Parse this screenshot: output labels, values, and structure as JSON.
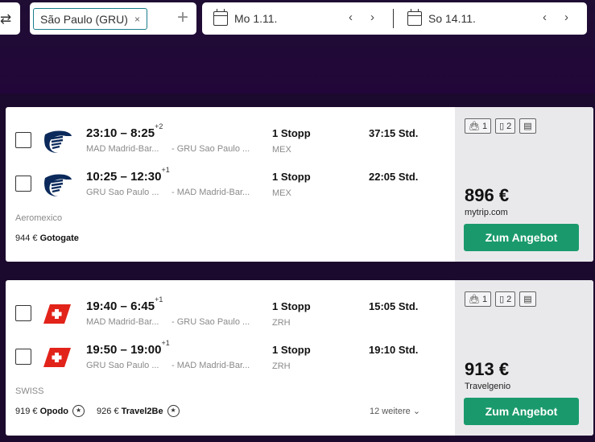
{
  "search": {
    "origin_chip": "São Paulo (GRU)",
    "chip_close": "×",
    "add_symbol": "+",
    "depart_date": "Mo 1.11.",
    "return_date": "So 14.11.",
    "prev": "‹",
    "next": "›",
    "swap_symbol": "⇄"
  },
  "results": [
    {
      "legs": [
        {
          "depart": "23:10",
          "arrive": "8:25",
          "plus_days": "+2",
          "from": "MAD Madrid-Bar...",
          "to": "- GRU Sao Paulo ...",
          "stops": "1 Stopp",
          "via": "MEX",
          "duration": "37:15 Std."
        },
        {
          "depart": "10:25",
          "arrive": "12:30",
          "plus_days": "+1",
          "from": "GRU Sao Paulo ...",
          "to": "- MAD Madrid-Bar...",
          "stops": "1 Stopp",
          "via": "MEX",
          "duration": "22:05 Std."
        }
      ],
      "airline": "Aeromexico",
      "alt_offers": [
        {
          "price": "944 €",
          "provider": "Gotogate"
        }
      ],
      "bags": [
        "1",
        "2"
      ],
      "price": "896 €",
      "provider": "mytrip.com",
      "cta": "Zum Angebot",
      "logo_color": "#0b2a5b"
    },
    {
      "legs": [
        {
          "depart": "19:40",
          "arrive": "6:45",
          "plus_days": "+1",
          "from": "MAD Madrid-Bar...",
          "to": "- GRU Sao Paulo ...",
          "stops": "1 Stopp",
          "via": "ZRH",
          "duration": "15:05 Std."
        },
        {
          "depart": "19:50",
          "arrive": "19:00",
          "plus_days": "+1",
          "from": "GRU Sao Paulo ...",
          "to": "- MAD Madrid-Bar...",
          "stops": "1 Stopp",
          "via": "ZRH",
          "duration": "19:10 Std."
        }
      ],
      "airline": "SWISS",
      "alt_offers": [
        {
          "price": "919 €",
          "provider": "Opodo"
        },
        {
          "price": "926 €",
          "provider": "Travel2Be"
        }
      ],
      "more": "12 weitere",
      "bags": [
        "1",
        "2"
      ],
      "price": "913 €",
      "provider": "Travelgenio",
      "cta": "Zum Angebot",
      "logo_color": "#e2231a"
    }
  ],
  "colors": {
    "cta": "#1a9a6c",
    "header_bg": "#1f0d33",
    "chip_border": "#1a7d8c"
  }
}
